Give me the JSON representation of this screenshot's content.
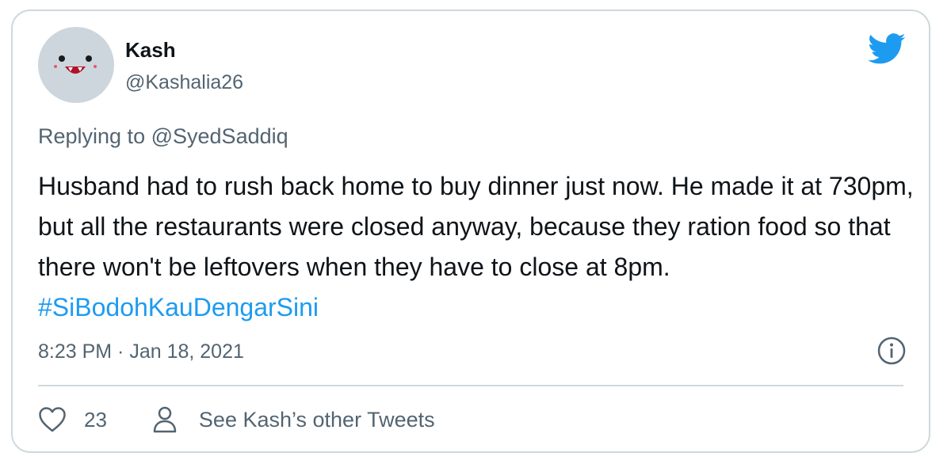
{
  "tweet": {
    "author_name": "Kash",
    "author_handle": "@Kashalia26",
    "replying_prefix": "Replying to",
    "replying_to": "@SyedSaddiq",
    "text": "Husband had to rush back home to buy dinner just now. He made it at 730pm, but all the restaurants were closed anyway, because they ration food so that there won't be leftovers when they have to close at 8pm.",
    "hashtag": "#SiBodohKauDengarSini",
    "timestamp": "8:23 PM · Jan 18, 2021"
  },
  "footer": {
    "like_count": "23",
    "other_tweets_label": "See Kash’s other Tweets"
  },
  "icons": {
    "logo": "twitter-bird-icon",
    "info": "info-icon",
    "like": "heart-icon",
    "profile": "person-icon"
  },
  "colors": {
    "twitter_blue": "#1d9bf0",
    "text_primary": "#0f1419",
    "text_secondary": "#536471",
    "border": "#cfd9de",
    "avatar_bg": "#cdd6dd"
  }
}
